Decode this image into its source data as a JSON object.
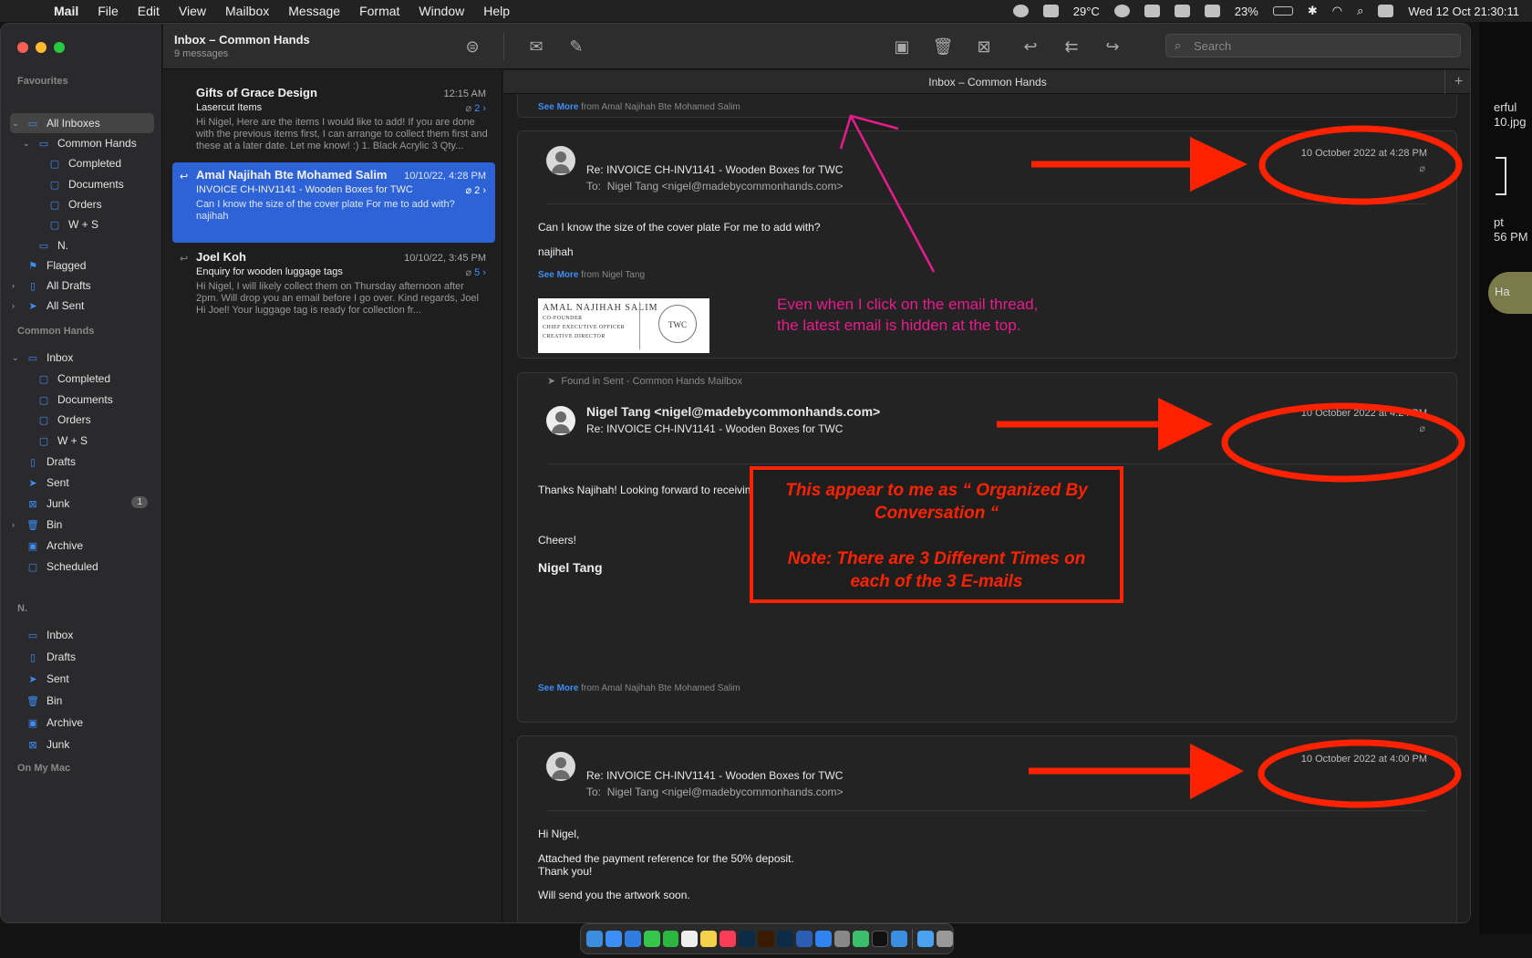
{
  "menubar": {
    "app_name": "Mail",
    "items": [
      "File",
      "Edit",
      "View",
      "Mailbox",
      "Message",
      "Format",
      "Window",
      "Help"
    ],
    "temperature": "29°C",
    "battery": "23%",
    "datetime": "Wed 12 Oct  21:30:11"
  },
  "desktop": {
    "text1": "erful",
    "text2": "10.jpg",
    "text3": "pt",
    "text4": "56 PM",
    "pill": "Ha"
  },
  "sidebar": {
    "favourites_label": "Favourites",
    "favourites": [
      {
        "label": "All Inboxes",
        "icon": "inbox-icon"
      },
      {
        "label": "Common Hands",
        "icon": "inbox-icon"
      },
      {
        "label": "Completed",
        "icon": "folder-icon"
      },
      {
        "label": "Documents",
        "icon": "folder-icon"
      },
      {
        "label": "Orders",
        "icon": "folder-icon"
      },
      {
        "label": "W + S",
        "icon": "folder-icon"
      },
      {
        "label": "N.",
        "icon": "inbox-icon"
      },
      {
        "label": "Flagged",
        "icon": "flag-icon"
      },
      {
        "label": "All Drafts",
        "icon": "document-icon"
      },
      {
        "label": "All Sent",
        "icon": "paper-plane-icon"
      }
    ],
    "common_hands_label": "Common Hands",
    "common_hands": [
      {
        "label": "Inbox",
        "icon": "inbox-icon"
      },
      {
        "label": "Completed",
        "icon": "folder-icon"
      },
      {
        "label": "Documents",
        "icon": "folder-icon"
      },
      {
        "label": "Orders",
        "icon": "folder-icon"
      },
      {
        "label": "W + S",
        "icon": "folder-icon"
      },
      {
        "label": "Drafts",
        "icon": "document-icon"
      },
      {
        "label": "Sent",
        "icon": "paper-plane-icon"
      },
      {
        "label": "Junk",
        "icon": "junk-icon",
        "badge": "1"
      },
      {
        "label": "Bin",
        "icon": "trash-icon"
      },
      {
        "label": "Archive",
        "icon": "archive-icon"
      },
      {
        "label": "Scheduled",
        "icon": "folder-icon"
      }
    ],
    "n_label": "N.",
    "n_items": [
      {
        "label": "Inbox",
        "icon": "inbox-icon"
      },
      {
        "label": "Drafts",
        "icon": "document-icon"
      },
      {
        "label": "Sent",
        "icon": "paper-plane-icon"
      },
      {
        "label": "Bin",
        "icon": "trash-icon"
      },
      {
        "label": "Archive",
        "icon": "archive-icon"
      },
      {
        "label": "Junk",
        "icon": "junk-icon"
      }
    ],
    "on_my_mac_label": "On My Mac"
  },
  "toolbar": {
    "title": "Inbox – Common Hands",
    "subtitle": "9 messages",
    "search_placeholder": "Search"
  },
  "tab": {
    "label": "Inbox – Common Hands",
    "plus": "+"
  },
  "messages": [
    {
      "from": "Gifts of Grace Design",
      "date": "12:15 AM",
      "subject": "Lasercut Items",
      "count": "2",
      "preview": "Hi Nigel, Here are the items I would like to add! If you are done with the previous items first, I can arrange to collect them first and these at a later date. Let me know! :) 1. Black Acrylic 3 Qty..."
    },
    {
      "from": "Amal Najihah Bte Mohamed Salim",
      "date": "10/10/22, 4:28 PM",
      "subject": "INVOICE CH-INV1141 - Wooden Boxes for TWC",
      "count": "2",
      "preview": "Can I know the size of the cover plate For me to add with? najihah"
    },
    {
      "from": "Joel Koh",
      "date": "10/10/22, 3:45 PM",
      "subject": "Enquiry for wooden luggage tags",
      "count": "5",
      "preview": "Hi Nigel, I will likely collect them on Thursday afternoon after 2pm. Will drop you an email before I go over. Kind regards, Joel Hi Joel! Your luggage tag is ready for collection fr..."
    }
  ],
  "reader": {
    "top_seemore": {
      "link": "See More",
      "from": "from Amal Najihah Bte Mohamed Salim"
    },
    "email1": {
      "subject": "Re: INVOICE CH-INV1141 - Wooden Boxes for TWC",
      "to_label": "To:",
      "to": "Nigel Tang <nigel@madebycommonhands.com>",
      "date": "10 October 2022 at 4:28 PM",
      "body1": "Can I know the size of the cover plate For me to add with?",
      "body2": "najihah",
      "seemore": {
        "link": "See More",
        "from": "from Nigel Tang"
      },
      "signature": {
        "name": "AMAL NAJIHAH SALIM",
        "role1": "CO-FOUNDER",
        "role2": "CHIEF EXECUTIVE OFFICER",
        "role3": "CREATIVE DIRECTOR",
        "seal": "TWC"
      }
    },
    "email2": {
      "found": "Found in Sent - Common Hands Mailbox",
      "from": "Nigel Tang <nigel@madebycommonhands.com>",
      "subject": "Re: INVOICE CH-INV1141 - Wooden Boxes for TWC",
      "date": "10 October 2022 at 4:24 PM",
      "body1": "Thanks Najihah! Looking forward to receiving the artwork.",
      "body2": "Cheers!",
      "signature": "Nigel Tang",
      "seemore": {
        "link": "See More",
        "from": "from Amal Najihah Bte Mohamed Salim"
      }
    },
    "email3": {
      "subject": "Re: INVOICE CH-INV1141 - Wooden Boxes for TWC",
      "to_label": "To:",
      "to": "Nigel Tang <nigel@madebycommonhands.com>",
      "date": "10 October 2022 at 4:00 PM",
      "body1": "Hi Nigel,",
      "body2": "Attached the payment reference for the 50% deposit.",
      "body3": "Thank you!",
      "body4": "Will send you the artwork soon."
    }
  },
  "annotations": {
    "pink_line1": "Even when I click on the email thread,",
    "pink_line2": "the latest email is hidden at the top.",
    "box_line1": "This appear to me  as “ Organized By",
    "box_line2": "Conversation “",
    "box_line3": "Note: There are 3 Different Times on",
    "box_line4": "each of the  3 E-mails",
    "red": "#ff2200",
    "pink": "#e81c8c"
  }
}
